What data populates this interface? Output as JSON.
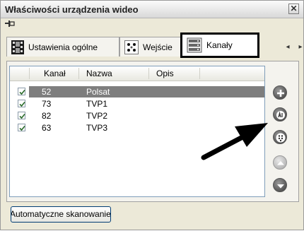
{
  "window": {
    "title": "Właściwości urządzenia wideo"
  },
  "tabs": [
    {
      "label": "Ustawienia ogólne",
      "icon": "film-icon"
    },
    {
      "label": "Wejście",
      "icon": "grid-icon"
    },
    {
      "label": "Kanały",
      "icon": "server-icon"
    }
  ],
  "table": {
    "columns": [
      "Kanał",
      "Nazwa",
      "Opis"
    ],
    "rows": [
      {
        "channel": "52",
        "name": "Polsat",
        "desc": "",
        "checked": true,
        "selected": true
      },
      {
        "channel": "73",
        "name": "TVP1",
        "desc": "",
        "checked": true,
        "selected": false
      },
      {
        "channel": "82",
        "name": "TVP2",
        "desc": "",
        "checked": true,
        "selected": false
      },
      {
        "channel": "63",
        "name": "TVP3",
        "desc": "",
        "checked": true,
        "selected": false
      }
    ]
  },
  "side_buttons": [
    {
      "name": "add-button",
      "icon": "plus-icon"
    },
    {
      "name": "auto-button",
      "icon": "ai-icon"
    },
    {
      "name": "numbering-button",
      "icon": "keypad-icon"
    },
    {
      "name": "move-up-button",
      "icon": "up-arrow-icon"
    },
    {
      "name": "move-down-button",
      "icon": "down-arrow-icon"
    }
  ],
  "scan_button_label": "Automatyczne skanowanie",
  "colors": {
    "selected_row": "#7e7e7e",
    "highlight_border": "#000000"
  }
}
